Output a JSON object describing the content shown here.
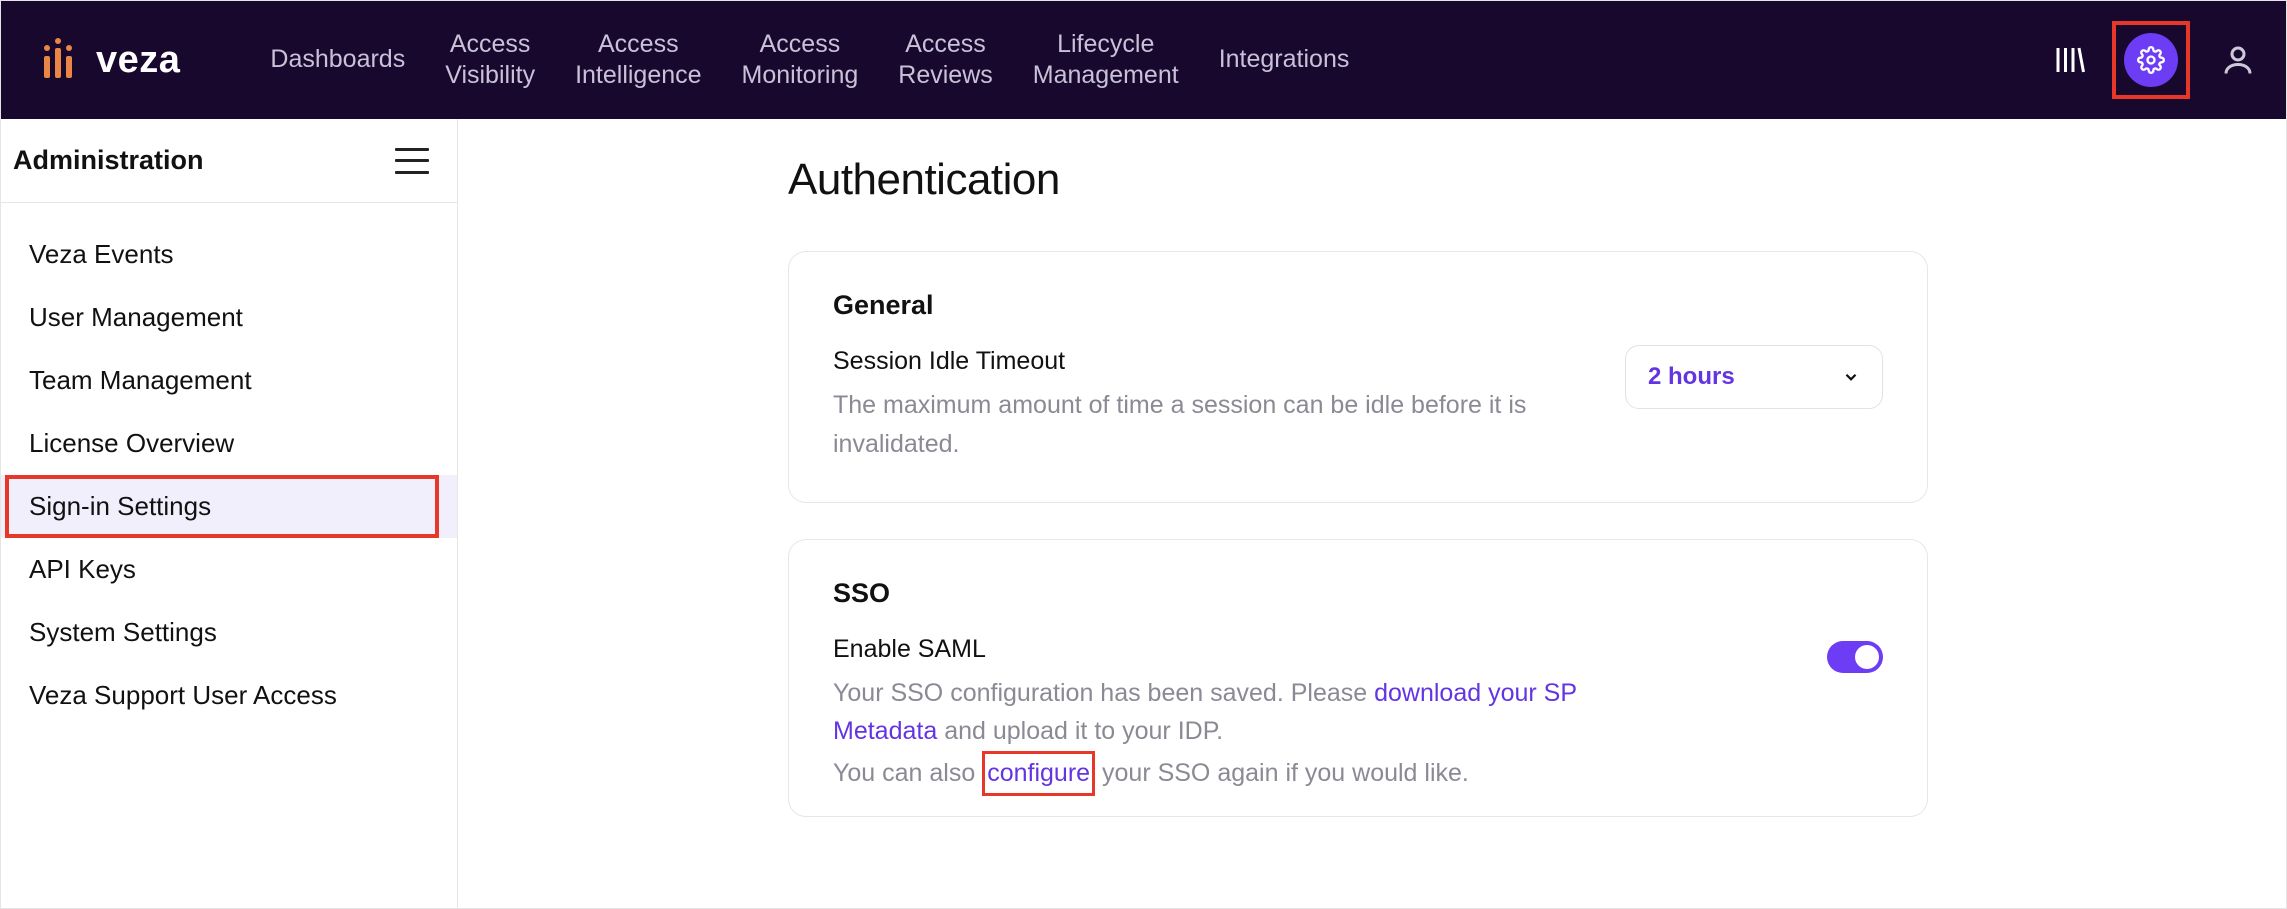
{
  "brand": {
    "name": "veza"
  },
  "nav": {
    "items": [
      "Dashboards",
      "Access\nVisibility",
      "Access\nIntelligence",
      "Access\nMonitoring",
      "Access\nReviews",
      "Lifecycle\nManagement",
      "Integrations"
    ]
  },
  "sidebar": {
    "title": "Administration",
    "items": [
      {
        "label": "Veza Events",
        "active": false
      },
      {
        "label": "User Management",
        "active": false
      },
      {
        "label": "Team Management",
        "active": false
      },
      {
        "label": "License Overview",
        "active": false
      },
      {
        "label": "Sign-in Settings",
        "active": true
      },
      {
        "label": "API Keys",
        "active": false
      },
      {
        "label": "System Settings",
        "active": false
      },
      {
        "label": "Veza Support User Access",
        "active": false
      }
    ]
  },
  "page": {
    "title": "Authentication",
    "general": {
      "heading": "General",
      "setting_label": "Session Idle Timeout",
      "setting_desc": "The maximum amount of time a session can be idle before it is invalidated.",
      "select_value": "2 hours"
    },
    "sso": {
      "heading": "SSO",
      "setting_label": "Enable SAML",
      "desc_prefix": "Your SSO configuration has been saved. Please ",
      "download_link": "download your SP Metadata",
      "desc_mid": " and upload it to your IDP.",
      "desc2_prefix": "You can also ",
      "configure_link": "configure",
      "desc2_suffix": " your SSO again if you would like."
    }
  }
}
